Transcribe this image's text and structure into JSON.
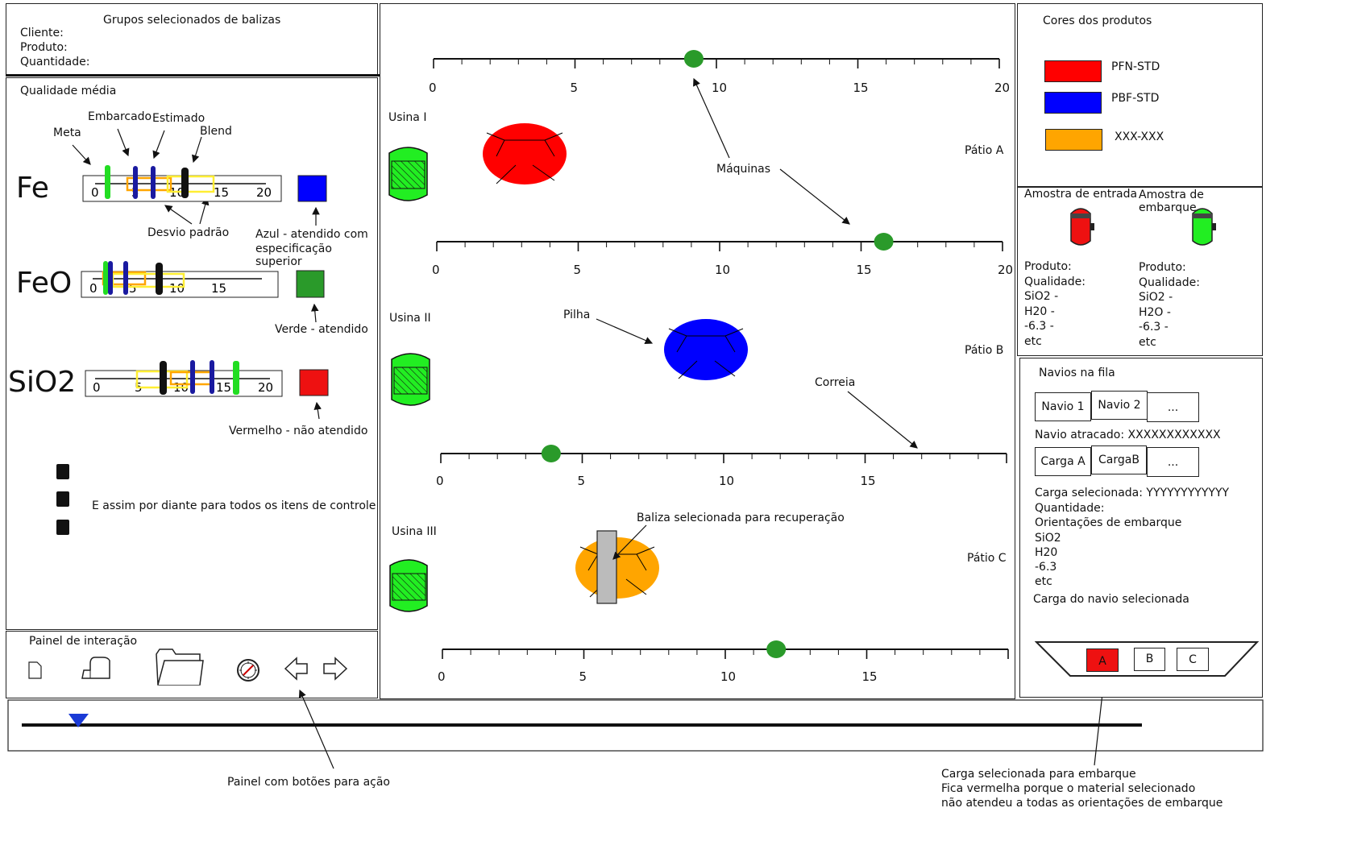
{
  "groups": {
    "title": "Grupos selecionados de balizas",
    "client_label": "Cliente:",
    "product_label": "Produto:",
    "quantity_label": "Quantidade:"
  },
  "quality": {
    "title": "Qualidade média",
    "legend": {
      "meta": "Meta",
      "embarcado": "Embarcado",
      "estimado": "Estimado",
      "blend": "Blend",
      "desvio": "Desvio padrão"
    },
    "items": [
      {
        "name": "Fe",
        "ticks": [
          "0",
          "5",
          "10",
          "15",
          "20"
        ],
        "status_color": "#0000ff",
        "status_text_1": "Azul - atendido com",
        "status_text_2": "especificação superior"
      },
      {
        "name": "FeO",
        "ticks": [
          "0",
          "5",
          "10",
          "15"
        ],
        "status_color": "#2a9a2a",
        "status_text_1": "Verde - atendido"
      },
      {
        "name": "SiO2",
        "ticks": [
          "0",
          "5",
          "10",
          "15",
          "20"
        ],
        "status_color": "#ee1111",
        "status_text_1": "Vermelho - não atendido"
      }
    ],
    "etc_text": "E assim por diante para todos os itens de controle"
  },
  "interaction": {
    "title": "Painel de interação",
    "icons": [
      "new-file-icon",
      "eraser-icon",
      "folder-icon",
      "compass-icon",
      "arrow-left-icon",
      "arrow-right-icon"
    ]
  },
  "yard": {
    "rulers": [
      {
        "ticks": [
          "0",
          "5",
          "10",
          "15",
          "20"
        ],
        "machine_pos": 9.2
      },
      {
        "ticks": [
          "0",
          "5",
          "10",
          "15",
          "20"
        ],
        "machine_pos": 15.8
      },
      {
        "ticks": [
          "0",
          "5",
          "10",
          "15"
        ],
        "machine_pos": 3.9
      },
      {
        "ticks": [
          "0",
          "5",
          "10",
          "15"
        ],
        "machine_pos": 11.8
      }
    ],
    "usinas": [
      "Usina I",
      "Usina II",
      "Usina III"
    ],
    "patios": [
      "Pátio A",
      "Pátio B",
      "Pátio C"
    ],
    "annotations": {
      "maquinas": "Máquinas",
      "pilha": "Pilha",
      "correia": "Correia",
      "baliza": "Baliza selecionada para recuperação"
    },
    "pile_colors": [
      "#ff0000",
      "#0000ff",
      "#ffa500"
    ]
  },
  "products": {
    "title": "Cores dos produtos",
    "items": [
      {
        "label": "PFN-STD",
        "color": "#ff0000"
      },
      {
        "label": "PBF-STD",
        "color": "#0000ff"
      },
      {
        "label": "XXX-XXX",
        "color": "#ffa500"
      }
    ]
  },
  "samples": {
    "entry_title": "Amostra de entrada",
    "ship_title": "Amostra de embarque",
    "lines": [
      "Produto:",
      "Qualidade:",
      "SiO2 -",
      "H20 -",
      "-6.3 -",
      "etc"
    ],
    "lines_ship": [
      "Produto:",
      "Qualidade:",
      "SiO2 -",
      "H2O -",
      "-6.3 -",
      "etc"
    ]
  },
  "ships": {
    "title": "Navios na fila",
    "tabs": [
      "Navio 1",
      "Navio 2",
      "..."
    ],
    "docked": "Navio atracado: XXXXXXXXXXXX",
    "cargo_tabs": [
      "Carga A",
      "CargaB",
      "..."
    ],
    "selected_cargo": "Carga selecionada: YYYYYYYYYYYY",
    "info": [
      "Quantidade:",
      "Orientações de embarque",
      "SiO2",
      "H20",
      "-6.3",
      "etc"
    ],
    "selected_ship_cargo": "Carga do navio selecionada",
    "holds": [
      "A",
      "B",
      "C"
    ]
  },
  "footnotes": {
    "panel_buttons": "Painel com botões para ação",
    "cargo_note_1": "Carga selecionada para embarque",
    "cargo_note_2": "Fica vermelha porque o material selecionado",
    "cargo_note_3": "não atendeu a todas as orientações de embarque"
  }
}
